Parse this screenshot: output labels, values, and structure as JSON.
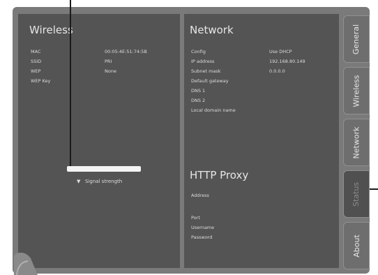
{
  "wireless": {
    "title": "Wireless",
    "rows": [
      {
        "label": "MAC",
        "value": "00:05:4E:51:74:5B"
      },
      {
        "label": "SSID",
        "value": "PRI"
      },
      {
        "label": "WEP",
        "value": "None"
      },
      {
        "label": "WEP Key",
        "value": ""
      }
    ],
    "signal_label": "Signal strength",
    "signal_level": 1.0
  },
  "network": {
    "title": "Network",
    "rows": [
      {
        "label": "Config",
        "value": "Use DHCP"
      },
      {
        "label": "IP address",
        "value": "192.168.80.149"
      },
      {
        "label": "Subnet mask",
        "value": "0.0.0.0"
      },
      {
        "label": "Default gateway",
        "value": ""
      },
      {
        "label": "DNS 1",
        "value": ""
      },
      {
        "label": "DNS 2",
        "value": ""
      },
      {
        "label": "Local domain name",
        "value": ""
      }
    ]
  },
  "proxy": {
    "title": "HTTP Proxy",
    "rows": [
      {
        "label": "Address"
      },
      {
        "label": "Port"
      },
      {
        "label": "Username"
      },
      {
        "label": "Password"
      }
    ]
  },
  "tabs": [
    {
      "label": "General"
    },
    {
      "label": "Wireless"
    },
    {
      "label": "Network"
    },
    {
      "label": "Status"
    },
    {
      "label": "About"
    }
  ]
}
